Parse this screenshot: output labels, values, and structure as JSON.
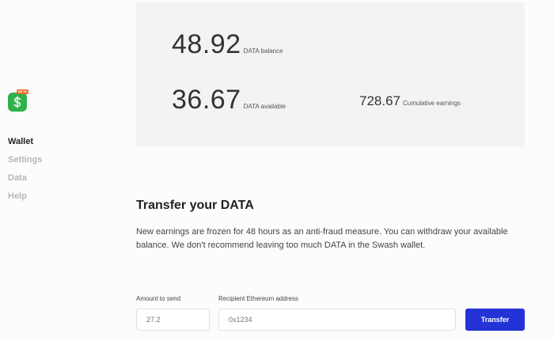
{
  "sidebar": {
    "beta_badge": "BETA",
    "items": [
      {
        "label": "Wallet",
        "active": true
      },
      {
        "label": "Settings",
        "active": false
      },
      {
        "label": "Data",
        "active": false
      },
      {
        "label": "Help",
        "active": false
      }
    ]
  },
  "balance": {
    "data_balance": {
      "value": "48.92",
      "label": "DATA balance"
    },
    "data_available": {
      "value": "36.67",
      "label": "DATA available"
    },
    "cumulative": {
      "value": "728.67",
      "label": "Cumulative earnings"
    }
  },
  "transfer": {
    "title": "Transfer your DATA",
    "description": "New earnings are frozen for 48 hours as an anti-fraud measure. You can withdraw your available balance. We don't recommend leaving too much DATA in the Swash wallet.",
    "amount_label": "Amount to send",
    "amount_placeholder": "27.2",
    "address_label": "Recipient Ethereum address",
    "address_placeholder": "0x1234",
    "button_label": "Transfer"
  },
  "colors": {
    "brand_green": "#2fb24a",
    "beta_orange": "#f06a23",
    "primary_button": "#2433d6",
    "card_background": "#f3f3f3"
  },
  "icons": {
    "logo": "dollar-sign-icon"
  }
}
